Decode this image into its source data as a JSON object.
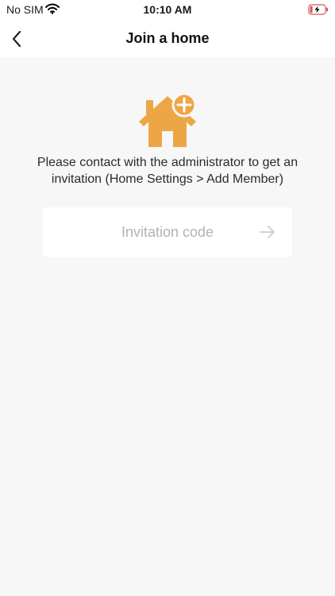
{
  "status_bar": {
    "carrier": "No SIM",
    "time": "10:10 AM",
    "wifi_icon": "wifi-icon",
    "battery_icon": "battery-charging-icon"
  },
  "nav": {
    "back_icon": "chevron-left-icon",
    "title": "Join a home"
  },
  "main": {
    "icon": "home-add-icon",
    "accent_color": "#EDA645",
    "instruction": "Please contact with the administrator to get an invitation (Home Settings > Add Member)",
    "invitation": {
      "placeholder": "Invitation code",
      "value": "",
      "submit_icon": "arrow-right-icon"
    }
  }
}
